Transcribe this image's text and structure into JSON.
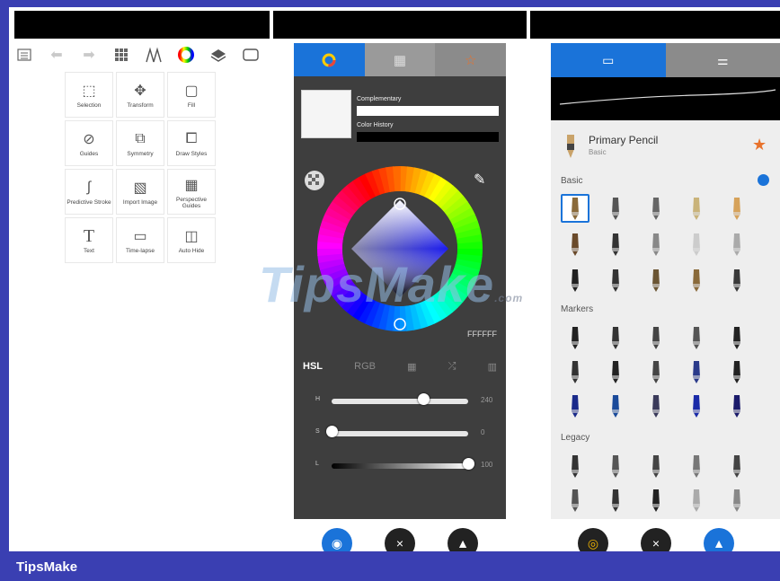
{
  "footer": {
    "brand": "TipsMake"
  },
  "watermark": {
    "text": "TipsMake",
    "suffix": ".com"
  },
  "toolbar": {
    "icons": [
      "layers-list-icon",
      "undo-icon",
      "redo-icon",
      "grid-menu-icon",
      "brushes-icon",
      "color-wheel-icon",
      "layer-stack-icon",
      "fullscreen-icon"
    ]
  },
  "tools": [
    {
      "label": "Selection",
      "icon": "selection-icon"
    },
    {
      "label": "Transform",
      "icon": "transform-icon"
    },
    {
      "label": "Fill",
      "icon": "fill-icon"
    },
    {
      "label": "Guides",
      "icon": "guides-icon"
    },
    {
      "label": "Symmetry",
      "icon": "symmetry-icon"
    },
    {
      "label": "Draw Styles",
      "icon": "draw-styles-icon"
    },
    {
      "label": "Predictive Stroke",
      "icon": "predictive-stroke-icon"
    },
    {
      "label": "Import Image",
      "icon": "import-image-icon"
    },
    {
      "label": "Perspective Guides",
      "icon": "perspective-guides-icon"
    },
    {
      "label": "Text",
      "icon": "text-icon"
    },
    {
      "label": "Time-lapse",
      "icon": "time-lapse-icon"
    },
    {
      "label": "Auto Hide",
      "icon": "auto-hide-icon"
    }
  ],
  "color_panel": {
    "tabs": [
      "color-wheel-tab",
      "swatch-grid-tab",
      "favorites-star-tab"
    ],
    "complementary_label": "Complementary",
    "history_label": "Color History",
    "hex": "FFFFFF",
    "modes": [
      "HSL",
      "RGB",
      "grid",
      "random",
      "gradient"
    ],
    "sliders": [
      {
        "letter": "H",
        "value": "240",
        "level": 0.67
      },
      {
        "letter": "S",
        "value": "0",
        "level": 0.0
      },
      {
        "letter": "L",
        "value": "100",
        "level": 1.0
      }
    ]
  },
  "brush_panel": {
    "brush_name": "Primary Pencil",
    "brush_category": "Basic",
    "sections": [
      "Basic",
      "Markers",
      "Legacy"
    ]
  },
  "colors": {
    "accent": "#1a73d9",
    "footer": "#3a3fb2",
    "panel_dark": "#3e3e3e",
    "favorite": "#e8722c"
  }
}
